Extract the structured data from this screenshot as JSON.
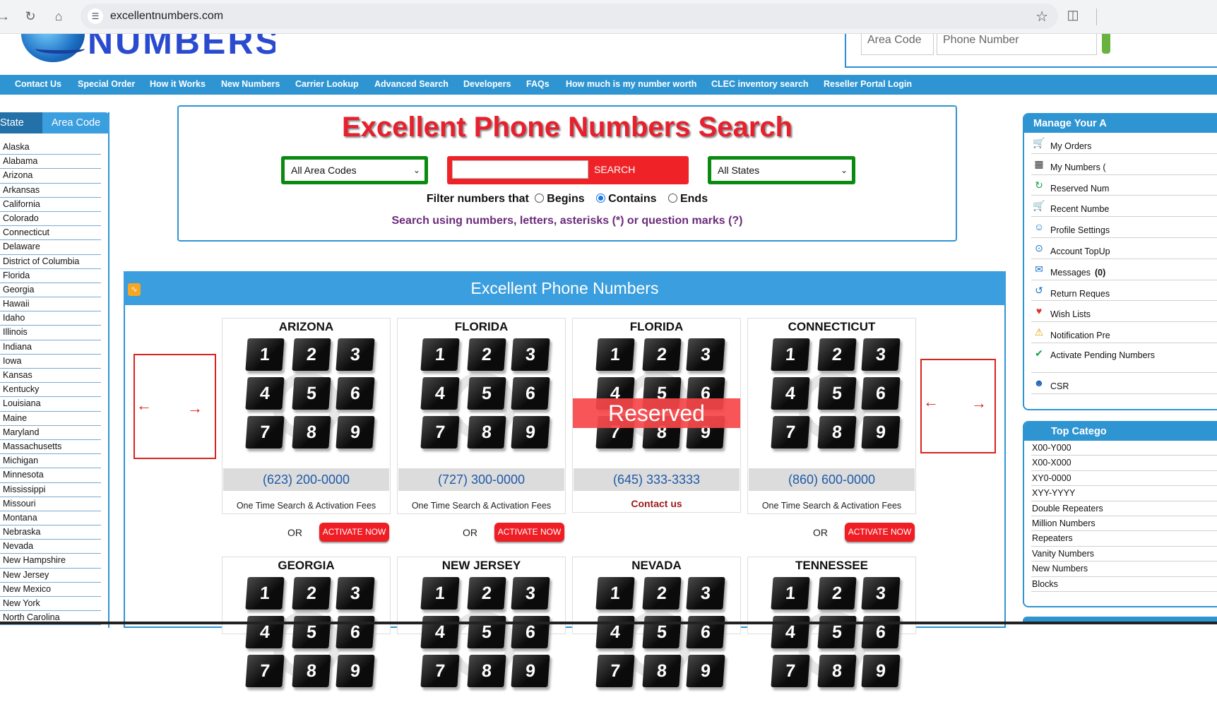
{
  "browser": {
    "url": "excellentnumbers.com"
  },
  "header": {
    "logo_text": "NUMBERS",
    "area_code_placeholder": "Area Code",
    "phone_number_placeholder": "Phone Number"
  },
  "nav": {
    "items": [
      "Contact Us",
      "Special Order",
      "How it Works",
      "New Numbers",
      "Carrier Lookup",
      "Advanced Search",
      "Developers",
      "FAQs",
      "How much is my number worth",
      "CLEC inventory search",
      "Reseller Portal Login"
    ]
  },
  "left_sidebar": {
    "tab_state": "State",
    "tab_area_code": "Area Code",
    "states": [
      "Alaska",
      "Alabama",
      "Arizona",
      "Arkansas",
      "California",
      "Colorado",
      "Connecticut",
      "Delaware",
      "District of Columbia",
      "Florida",
      "Georgia",
      "Hawaii",
      "Idaho",
      "Illinois",
      "Indiana",
      "Iowa",
      "Kansas",
      "Kentucky",
      "Louisiana",
      "Maine",
      "Maryland",
      "Massachusetts",
      "Michigan",
      "Minnesota",
      "Mississippi",
      "Missouri",
      "Montana",
      "Nebraska",
      "Nevada",
      "New Hampshire",
      "New Jersey",
      "New Mexico",
      "New York",
      "North Carolina"
    ]
  },
  "search": {
    "title": "Excellent Phone Numbers Search",
    "area_code_select": "All Area Codes",
    "state_select": "All States",
    "search_button": "SEARCH",
    "filter_label": "Filter numbers that",
    "opt_begins": "Begins",
    "opt_contains": "Contains",
    "opt_ends": "Ends",
    "help_text": "Search using numbers, letters, asterisks (*) or question marks (?)"
  },
  "listing": {
    "title": "Excellent Phone Numbers",
    "keys": [
      "1",
      "2",
      "3",
      "4",
      "5",
      "6",
      "7",
      "8",
      "9"
    ],
    "fees_text": "One Time Search & Activation Fees",
    "or_text": "OR",
    "activate_label": "ACTIVATE NOW",
    "reserved_label": "Reserved",
    "contact_label": "Contact us",
    "cards": [
      {
        "state": "ARIZONA",
        "number": "(623) 200-0000"
      },
      {
        "state": "FLORIDA",
        "number": "(727) 300-0000"
      },
      {
        "state": "FLORIDA",
        "number": "(645) 333-3333"
      },
      {
        "state": "CONNECTICUT",
        "number": "(860) 600-0000"
      },
      {
        "state": "GEORGIA"
      },
      {
        "state": "NEW JERSEY"
      },
      {
        "state": "NEVADA"
      },
      {
        "state": "TENNESSEE"
      }
    ]
  },
  "account_menu": {
    "title": "Manage Your A",
    "items": [
      "My Orders",
      "My Numbers (",
      "Reserved Num",
      "Recent Numbe",
      "Profile Settings",
      "Account TopUp",
      "Messages",
      "Return Reques",
      "Wish Lists",
      "Notification Pre",
      "Activate Pending Numbers",
      "CSR"
    ],
    "messages_count": "(0)"
  },
  "categories": {
    "title": "Top Catego",
    "items": [
      "X00-Y000",
      "X00-X000",
      "XY0-0000",
      "XYY-YYYY",
      "Double Repeaters",
      "Million Numbers",
      "Repeaters",
      "Vanity Numbers",
      "New Numbers",
      "Blocks"
    ]
  }
}
